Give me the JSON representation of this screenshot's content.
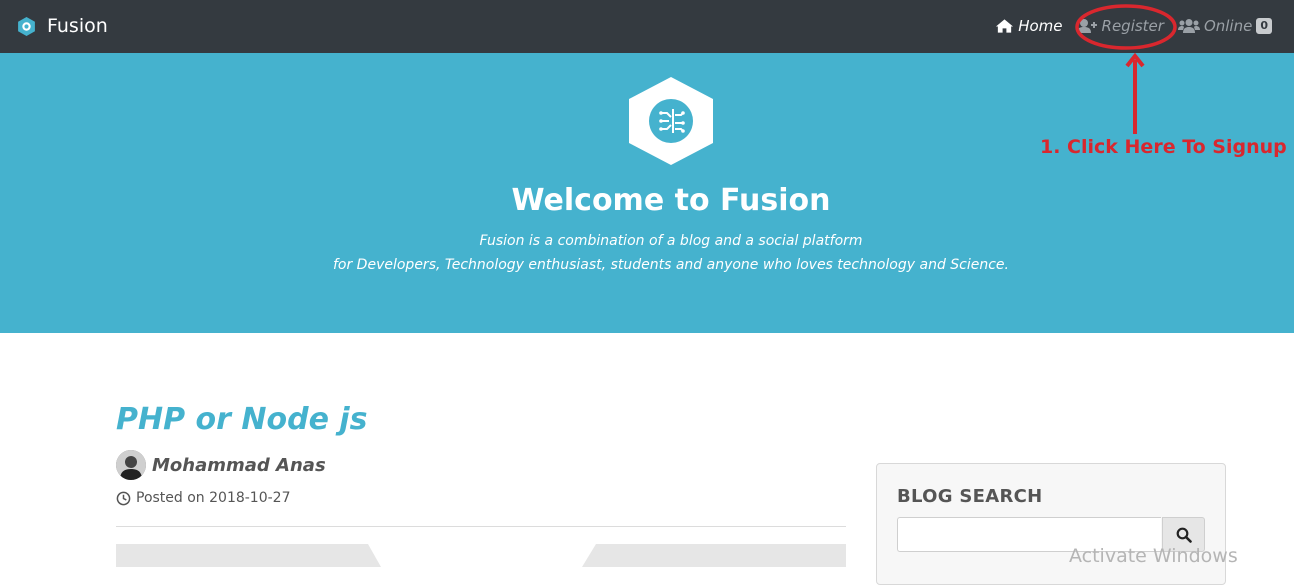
{
  "navbar": {
    "brand": "Fusion",
    "items": [
      {
        "label": "Home",
        "icon": "home-icon"
      },
      {
        "label": "Register",
        "icon": "user-plus-icon"
      },
      {
        "label": "Online",
        "icon": "users-icon",
        "badge": "0"
      }
    ]
  },
  "hero": {
    "title": "Welcome to Fusion",
    "subtitle_line1": "Fusion is a combination of a blog and a social platform",
    "subtitle_line2": "for Developers, Technology enthusiast, students and anyone who loves technology and Science."
  },
  "annotation": {
    "text": "1. Click Here To Signup",
    "color": "#d9272e"
  },
  "post": {
    "title": "PHP or Node js",
    "author": "Mohammad Anas",
    "posted": "Posted on 2018-10-27"
  },
  "sidebar": {
    "title": "BLOG SEARCH",
    "search_placeholder": ""
  },
  "watermark": "Activate Windows",
  "colors": {
    "navbar_bg": "#343a40",
    "hero_bg": "#45b2ce",
    "accent": "#45b2ce",
    "annotation": "#d9272e"
  }
}
